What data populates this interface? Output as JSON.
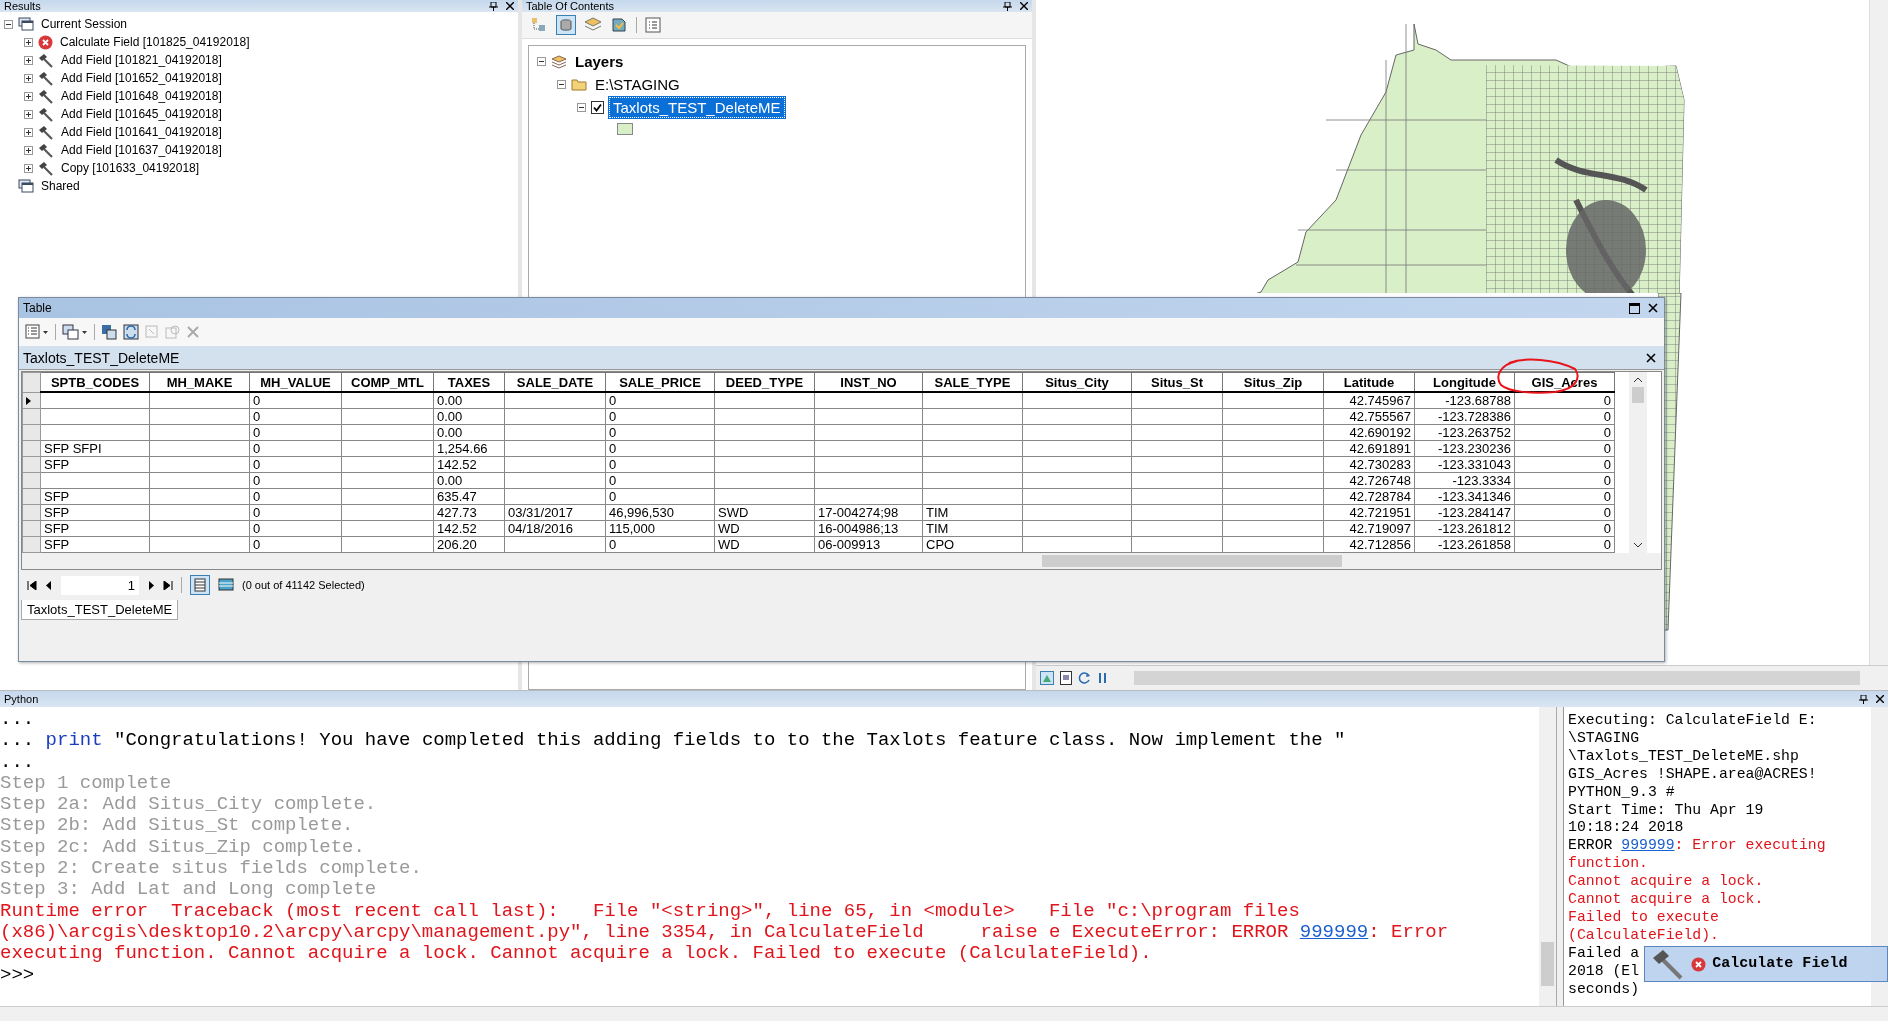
{
  "results": {
    "title": "Results",
    "tree": [
      {
        "label": "Current Session",
        "kind": "session",
        "expanded": true,
        "children": [
          {
            "label": "Calculate Field [101825_04192018]",
            "kind": "failed",
            "expanded": false
          },
          {
            "label": "Add Field [101821_04192018]",
            "kind": "tool",
            "expanded": false
          },
          {
            "label": "Add Field [101652_04192018]",
            "kind": "tool",
            "expanded": false
          },
          {
            "label": "Add Field [101648_04192018]",
            "kind": "tool",
            "expanded": false
          },
          {
            "label": "Add Field [101645_04192018]",
            "kind": "tool",
            "expanded": false
          },
          {
            "label": "Add Field [101641_04192018]",
            "kind": "tool",
            "expanded": false
          },
          {
            "label": "Add Field [101637_04192018]",
            "kind": "tool",
            "expanded": false
          },
          {
            "label": "Copy [101633_04192018]",
            "kind": "tool",
            "expanded": false
          }
        ]
      },
      {
        "label": "Shared",
        "kind": "session"
      }
    ]
  },
  "toc": {
    "title": "Table Of Contents",
    "tree": [
      {
        "label": "Layers",
        "kind": "group",
        "expanded": true,
        "children": [
          {
            "label": "E:\\STAGING",
            "kind": "folder",
            "expanded": true,
            "children": [
              {
                "label": "Taxlots_TEST_DeleteME",
                "kind": "layer",
                "expanded": true,
                "checked": true,
                "selected": true
              }
            ]
          }
        ]
      }
    ]
  },
  "table_window": {
    "title": "Table",
    "layer_title": "Taxlots_TEST_DeleteME",
    "columns": [
      "SPTB_CODES",
      "MH_MAKE",
      "MH_VALUE",
      "COMP_MTL",
      "TAXES",
      "SALE_DATE",
      "SALE_PRICE",
      "DEED_TYPE",
      "INST_NO",
      "SALE_TYPE",
      "Situs_City",
      "Situs_St",
      "Situs_Zip",
      "Latitude",
      "Longitude",
      "GIS_Acres"
    ],
    "rows": [
      {
        "current": true,
        "cells": [
          "",
          "",
          "0",
          "",
          "0.00",
          "",
          "0",
          "",
          "",
          "",
          "",
          "",
          "",
          "42.745967",
          "-123.68788",
          "0"
        ]
      },
      {
        "current": false,
        "cells": [
          "",
          "",
          "0",
          "",
          "0.00",
          "",
          "0",
          "",
          "",
          "",
          "",
          "",
          "",
          "42.755567",
          "-123.728386",
          "0"
        ]
      },
      {
        "current": false,
        "cells": [
          "",
          "",
          "0",
          "",
          "0.00",
          "",
          "0",
          "",
          "",
          "",
          "",
          "",
          "",
          "42.690192",
          "-123.263752",
          "0"
        ]
      },
      {
        "current": false,
        "cells": [
          "SFP SFPI",
          "",
          "0",
          "",
          "1,254.66",
          "",
          "0",
          "",
          "",
          "",
          "",
          "",
          "",
          "42.691891",
          "-123.230236",
          "0"
        ]
      },
      {
        "current": false,
        "cells": [
          "SFP",
          "",
          "0",
          "",
          "142.52",
          "",
          "0",
          "",
          "",
          "",
          "",
          "",
          "",
          "42.730283",
          "-123.331043",
          "0"
        ]
      },
      {
        "current": false,
        "cells": [
          "",
          "",
          "0",
          "",
          "0.00",
          "",
          "0",
          "",
          "",
          "",
          "",
          "",
          "",
          "42.726748",
          "-123.3334",
          "0"
        ]
      },
      {
        "current": false,
        "cells": [
          "SFP",
          "",
          "0",
          "",
          "635.47",
          "",
          "0",
          "",
          "",
          "",
          "",
          "",
          "",
          "42.728784",
          "-123.341346",
          "0"
        ]
      },
      {
        "current": false,
        "cells": [
          "SFP",
          "",
          "0",
          "",
          "427.73",
          "03/31/2017",
          "46,996,530",
          "SWD",
          "17-004274;98",
          "TIM",
          "",
          "",
          "",
          "42.721951",
          "-123.284147",
          "0"
        ]
      },
      {
        "current": false,
        "cells": [
          "SFP",
          "",
          "0",
          "",
          "142.52",
          "04/18/2016",
          "115,000",
          "WD",
          "16-004986;13",
          "TIM",
          "",
          "",
          "",
          "42.719097",
          "-123.261812",
          "0"
        ]
      },
      {
        "current": false,
        "cells": [
          "SFP",
          "",
          "0",
          "",
          "206.20",
          "",
          "0",
          "WD",
          "06-009913",
          "CPO",
          "",
          "",
          "",
          "42.712856",
          "-123.261858",
          "0"
        ]
      }
    ],
    "record": "1",
    "selection_status": "(0 out of 41142 Selected)",
    "tabs": [
      {
        "label": "Taxlots_TEST_DeleteME",
        "selected": true
      }
    ]
  },
  "python": {
    "title": "Python",
    "console": [
      {
        "segments": [
          {
            "text": "...",
            "kind": "plain"
          }
        ]
      },
      {
        "segments": [
          {
            "text": "... ",
            "kind": "plain"
          },
          {
            "text": "print",
            "kind": "keyword"
          },
          {
            "text": " \"Congratulations! You have completed this adding fields to to the Taxlots feature class. Now implement the \"",
            "kind": "plain"
          }
        ]
      },
      {
        "segments": [
          {
            "text": "...",
            "kind": "plain"
          }
        ]
      },
      {
        "segments": [
          {
            "text": "Step 1 complete",
            "kind": "output"
          }
        ]
      },
      {
        "segments": [
          {
            "text": "Step 2a: Add Situs_City complete.",
            "kind": "output"
          }
        ]
      },
      {
        "segments": [
          {
            "text": "Step 2b: Add Situs_St complete.",
            "kind": "output"
          }
        ]
      },
      {
        "segments": [
          {
            "text": "Step 2c: Add Situs_Zip complete.",
            "kind": "output"
          }
        ]
      },
      {
        "segments": [
          {
            "text": "Step 2: Create situs fields complete.",
            "kind": "output"
          }
        ]
      },
      {
        "segments": [
          {
            "text": "Step 3: Add Lat and Long complete",
            "kind": "output"
          }
        ]
      },
      {
        "segments": [
          {
            "text": "Runtime error  Traceback (most recent call last):   File \"<string>\", line 65, in <module>   File \"c:\\program files (x86)\\arcgis\\desktop10.2\\arcpy\\arcpy\\management.py\", line 3354, in CalculateField     raise e ExecuteError: ERROR ",
            "kind": "error"
          },
          {
            "text": "999999",
            "kind": "link"
          },
          {
            "text": ": Error executing function. Cannot acquire a lock. Cannot acquire a lock. Failed to execute (CalculateField).",
            "kind": "error"
          }
        ]
      },
      {
        "segments": [
          {
            "text": ">>>",
            "kind": "plain"
          }
        ]
      }
    ],
    "messages": [
      {
        "segments": [
          {
            "text": "Executing: CalculateField E:",
            "kind": "plain"
          }
        ]
      },
      {
        "segments": [
          {
            "text": "\\STAGING",
            "kind": "plain"
          }
        ]
      },
      {
        "segments": [
          {
            "text": "\\Taxlots_TEST_DeleteME.shp",
            "kind": "plain"
          }
        ]
      },
      {
        "segments": [
          {
            "text": "GIS_Acres !SHAPE.area@ACRES!",
            "kind": "plain"
          }
        ]
      },
      {
        "segments": [
          {
            "text": "PYTHON_9.3 #",
            "kind": "plain"
          }
        ]
      },
      {
        "segments": [
          {
            "text": "Start Time: Thu Apr 19",
            "kind": "plain"
          }
        ]
      },
      {
        "segments": [
          {
            "text": "10:18:24 2018",
            "kind": "plain"
          }
        ]
      },
      {
        "segments": [
          {
            "text": "ERROR ",
            "kind": "plain"
          },
          {
            "text": "999999",
            "kind": "link"
          },
          {
            "text": ": Error executing",
            "kind": "error"
          }
        ]
      },
      {
        "segments": [
          {
            "text": "function.",
            "kind": "error"
          }
        ]
      },
      {
        "segments": [
          {
            "text": "Cannot acquire a lock.",
            "kind": "error"
          }
        ]
      },
      {
        "segments": [
          {
            "text": "Cannot acquire a lock.",
            "kind": "error"
          }
        ]
      },
      {
        "segments": [
          {
            "text": "Failed to execute",
            "kind": "error"
          }
        ]
      },
      {
        "segments": [
          {
            "text": "(CalculateField).",
            "kind": "error"
          }
        ]
      },
      {
        "segments": [
          {
            "text": "Failed a",
            "kind": "plain"
          }
        ]
      },
      {
        "segments": [
          {
            "text": "2018 (El",
            "kind": "plain"
          }
        ]
      },
      {
        "segments": [
          {
            "text": "seconds)",
            "kind": "plain"
          }
        ]
      }
    ]
  },
  "popup": {
    "title": "Calculate Field"
  }
}
